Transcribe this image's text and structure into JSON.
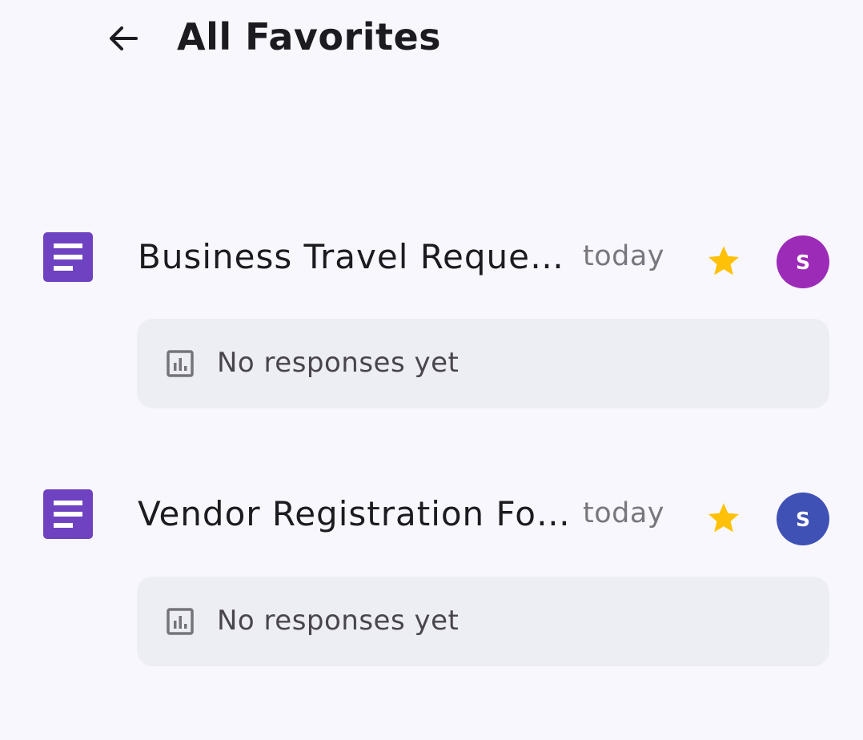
{
  "header": {
    "back_icon": "arrow-back-icon",
    "title": "All Favorites"
  },
  "colors": {
    "background": "#f8f7fd",
    "form_icon": "#6f42c1",
    "star": "#ffc107",
    "card": "#edeef3"
  },
  "forms": [
    {
      "title": "Business Travel Reque…",
      "date": "today",
      "starred": true,
      "avatar_letter": "S",
      "avatar_color": "#9c2bb8",
      "responses_label": "No responses yet"
    },
    {
      "title": "Vendor Registration Fo…",
      "date": "today",
      "starred": true,
      "avatar_letter": "S",
      "avatar_color": "#3f51b5",
      "responses_label": "No responses yet"
    }
  ]
}
